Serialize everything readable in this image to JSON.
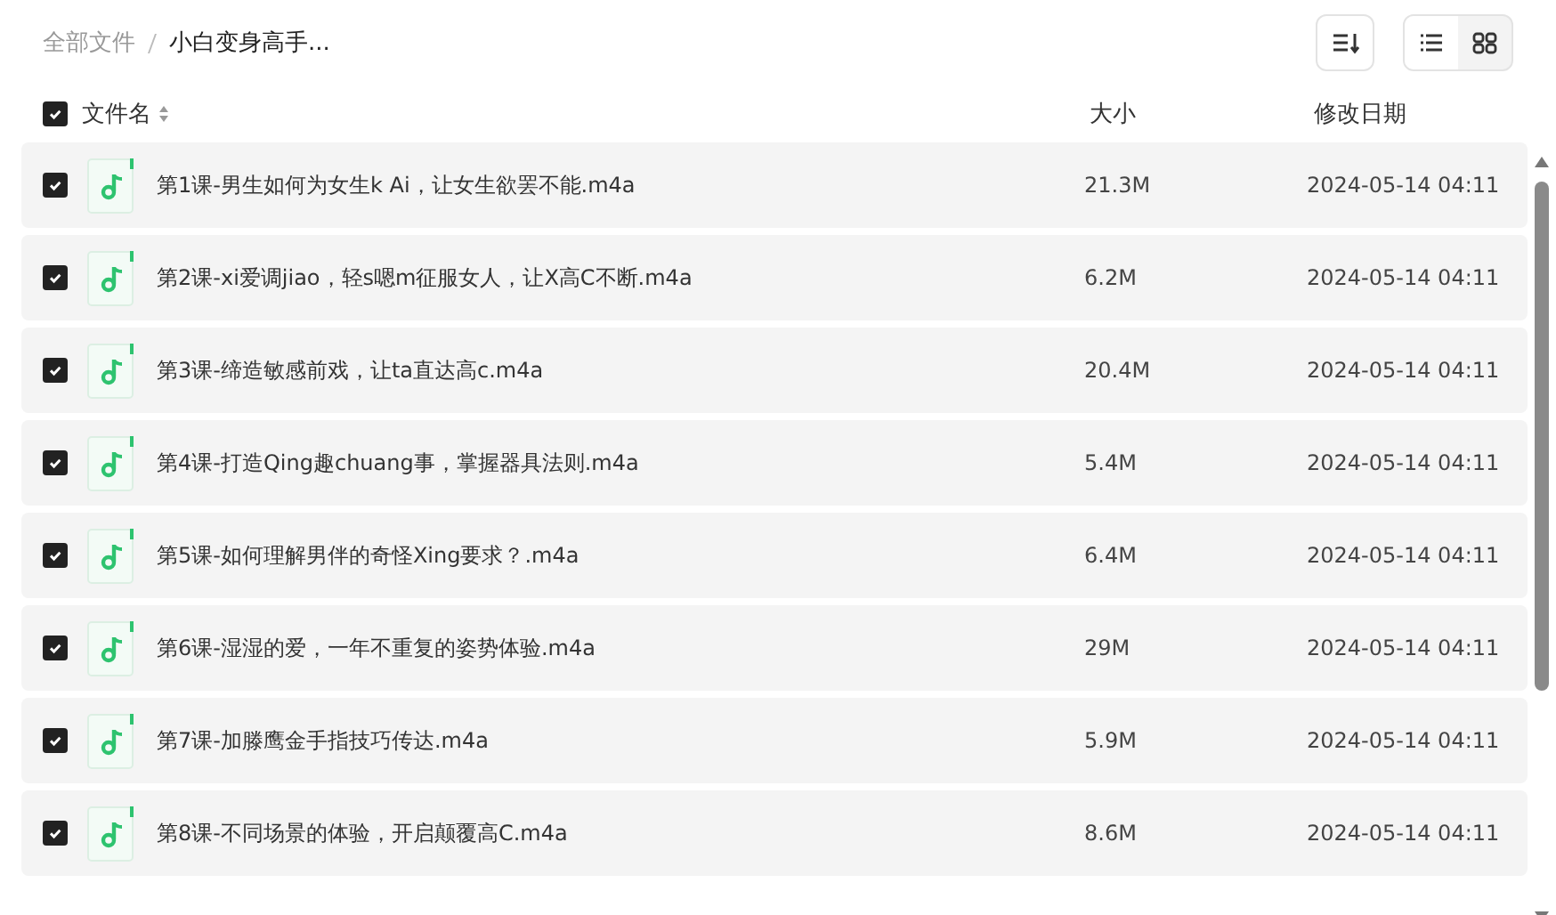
{
  "breadcrumb": [
    {
      "label": "全部文件",
      "current": false
    },
    {
      "label": "小白变身高手...",
      "current": true
    }
  ],
  "view_modes": [
    {
      "kind": "list",
      "selected": true
    },
    {
      "kind": "grid",
      "selected": false
    }
  ],
  "table": {
    "select_all": {
      "checked": true
    },
    "columns": [
      "文件名",
      "大小",
      "修改日期"
    ],
    "rows": [
      {
        "checked": true,
        "name": "第1课-男生如何为女生k Ai，让女生欲罢不能.m4a",
        "size": "21.3M",
        "modified": "2024-05-14 04:11"
      },
      {
        "checked": true,
        "name": "第2课-xi爱调jiao，轻s嗯m征服女人，让X高C不断.m4a",
        "size": "6.2M",
        "modified": "2024-05-14 04:11"
      },
      {
        "checked": true,
        "name": "第3课-缔造敏感前戏，让ta直达高c.m4a",
        "size": "20.4M",
        "modified": "2024-05-14 04:11"
      },
      {
        "checked": true,
        "name": "第4课-打造Qing趣chuang事，掌握器具法则.m4a",
        "size": "5.4M",
        "modified": "2024-05-14 04:11"
      },
      {
        "checked": true,
        "name": "第5课-如何理解男伴的奇怪Xing要求？.m4a",
        "size": "6.4M",
        "modified": "2024-05-14 04:11"
      },
      {
        "checked": true,
        "name": "第6课-湿湿的爱，一年不重复的姿势体验.m4a",
        "size": "29M",
        "modified": "2024-05-14 04:11"
      },
      {
        "checked": true,
        "name": "第7课-加滕鹰金手指技巧传达.m4a",
        "size": "5.9M",
        "modified": "2024-05-14 04:11"
      },
      {
        "checked": true,
        "name": "第8课-不同场景的体验，开启颠覆高C.m4a",
        "size": "8.6M",
        "modified": "2024-05-14 04:11"
      }
    ]
  }
}
